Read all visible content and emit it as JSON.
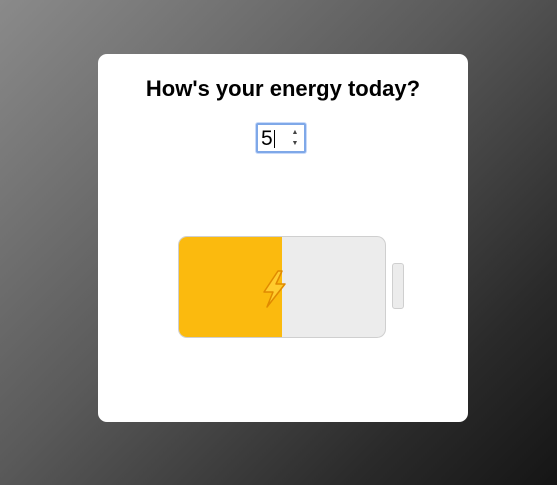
{
  "question": "How's your energy today?",
  "energy_input": {
    "value": "5"
  },
  "battery": {
    "level_fraction": 0.5,
    "fill_color": "#fbba0e",
    "empty_color": "#ececec",
    "icon": "lightning-bolt-icon"
  }
}
